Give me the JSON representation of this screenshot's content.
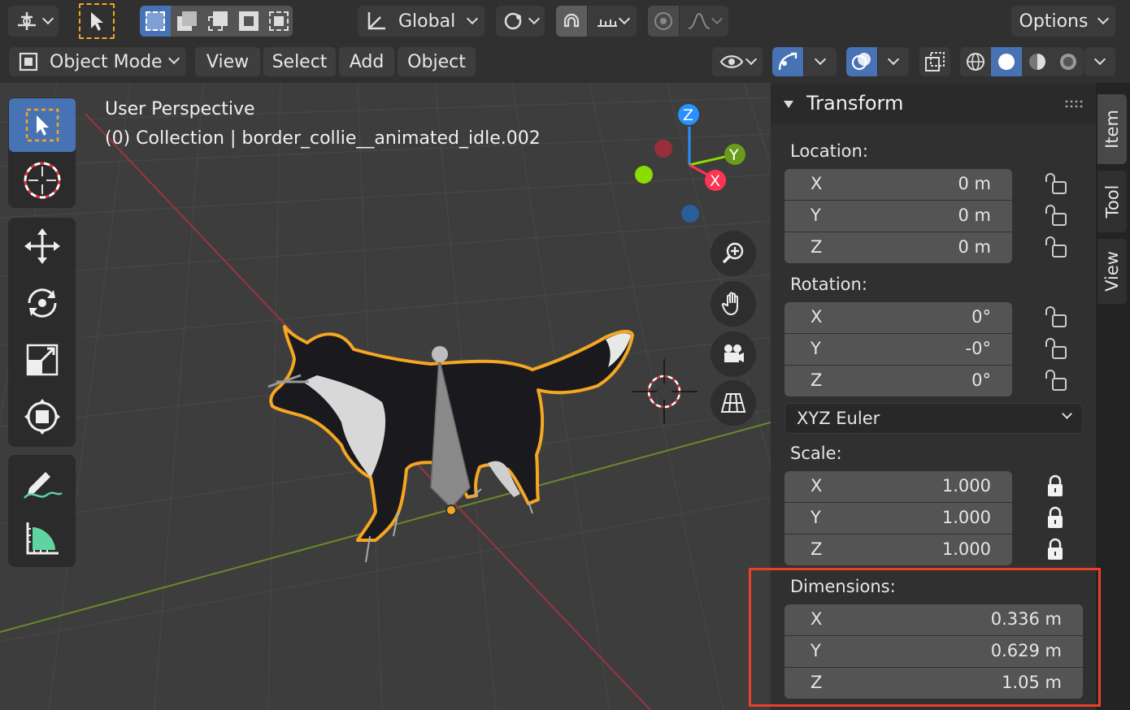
{
  "header": {
    "transform_orientation": "Global",
    "options_label": "Options"
  },
  "menubar": {
    "mode": "Object Mode",
    "view": "View",
    "select": "Select",
    "add": "Add",
    "object": "Object"
  },
  "viewport": {
    "perspective_label": "User Perspective",
    "collection_label": "(0) Collection | border_collie__animated_idle.002",
    "gizmo": {
      "x": "X",
      "y": "Y",
      "z": "Z"
    }
  },
  "panel": {
    "title": "Transform",
    "location": {
      "label": "Location:",
      "rows": [
        {
          "axis": "X",
          "value": "0 m"
        },
        {
          "axis": "Y",
          "value": "0 m"
        },
        {
          "axis": "Z",
          "value": "0 m"
        }
      ]
    },
    "rotation": {
      "label": "Rotation:",
      "rows": [
        {
          "axis": "X",
          "value": "0°"
        },
        {
          "axis": "Y",
          "value": "-0°"
        },
        {
          "axis": "Z",
          "value": "0°"
        }
      ],
      "mode": "XYZ Euler"
    },
    "scale": {
      "label": "Scale:",
      "rows": [
        {
          "axis": "X",
          "value": "1.000"
        },
        {
          "axis": "Y",
          "value": "1.000"
        },
        {
          "axis": "Z",
          "value": "1.000"
        }
      ]
    },
    "dimensions": {
      "label": "Dimensions:",
      "rows": [
        {
          "axis": "X",
          "value": "0.336 m"
        },
        {
          "axis": "Y",
          "value": "0.629 m"
        },
        {
          "axis": "Z",
          "value": "1.05 m"
        }
      ]
    }
  },
  "sidetabs": {
    "item": "Item",
    "tool": "Tool",
    "view": "View"
  },
  "colors": {
    "accent_blue": "#4772b3",
    "selection_orange": "#f5a623",
    "highlight_red": "#e8402a",
    "axis_x": "#ff3352",
    "axis_y": "#8bdc00",
    "axis_z": "#2890ff"
  }
}
